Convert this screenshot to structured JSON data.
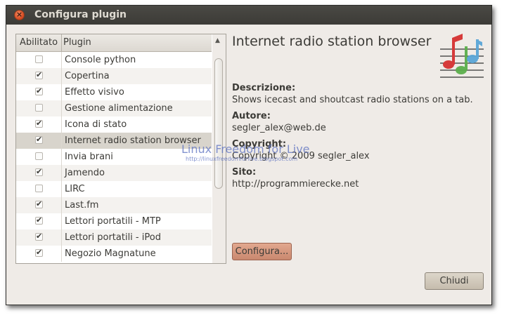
{
  "window": {
    "title": "Configura plugin",
    "close_glyph": "×"
  },
  "list": {
    "col_enabled": "Abilitato",
    "col_plugin": "Plugin",
    "rows": [
      {
        "label": "Console python",
        "checked": false
      },
      {
        "label": "Copertina",
        "checked": true
      },
      {
        "label": "Effetto visivo",
        "checked": true
      },
      {
        "label": "Gestione alimentazione",
        "checked": false
      },
      {
        "label": "Icona di stato",
        "checked": true
      },
      {
        "label": "Internet radio station browser",
        "checked": true,
        "selected": true
      },
      {
        "label": "Invia brani",
        "checked": false
      },
      {
        "label": "Jamendo",
        "checked": true
      },
      {
        "label": "LIRC",
        "checked": false
      },
      {
        "label": "Last.fm",
        "checked": true
      },
      {
        "label": "Lettori portatili - MTP",
        "checked": true
      },
      {
        "label": "Lettori portatili - iPod",
        "checked": true
      },
      {
        "label": "Negozio Magnatune",
        "checked": true
      }
    ],
    "scroll_up_glyph": "▲"
  },
  "details": {
    "title": "Internet radio station browser",
    "icon": "music-notes-icon",
    "description_label": "Descrizione:",
    "description": "Shows icecast and shoutcast radio stations on a tab.",
    "author_label": "Autore:",
    "author": "segler_alex@web.de",
    "copyright_label": "Copyright:",
    "copyright": "Copyright © 2009 segler_alex",
    "site_label": "Sito:",
    "site": "http://programmierecke.net"
  },
  "watermark": {
    "text": "Linux Freedom for Live",
    "url": "http://linuxfreedomforlive.blogspot.com"
  },
  "buttons": {
    "configure": "Configura...",
    "close": "Chiudi"
  },
  "colors": {
    "titlebar": "#3c3b37",
    "window_bg": "#efebe7",
    "accent_button": "#c9886f"
  }
}
